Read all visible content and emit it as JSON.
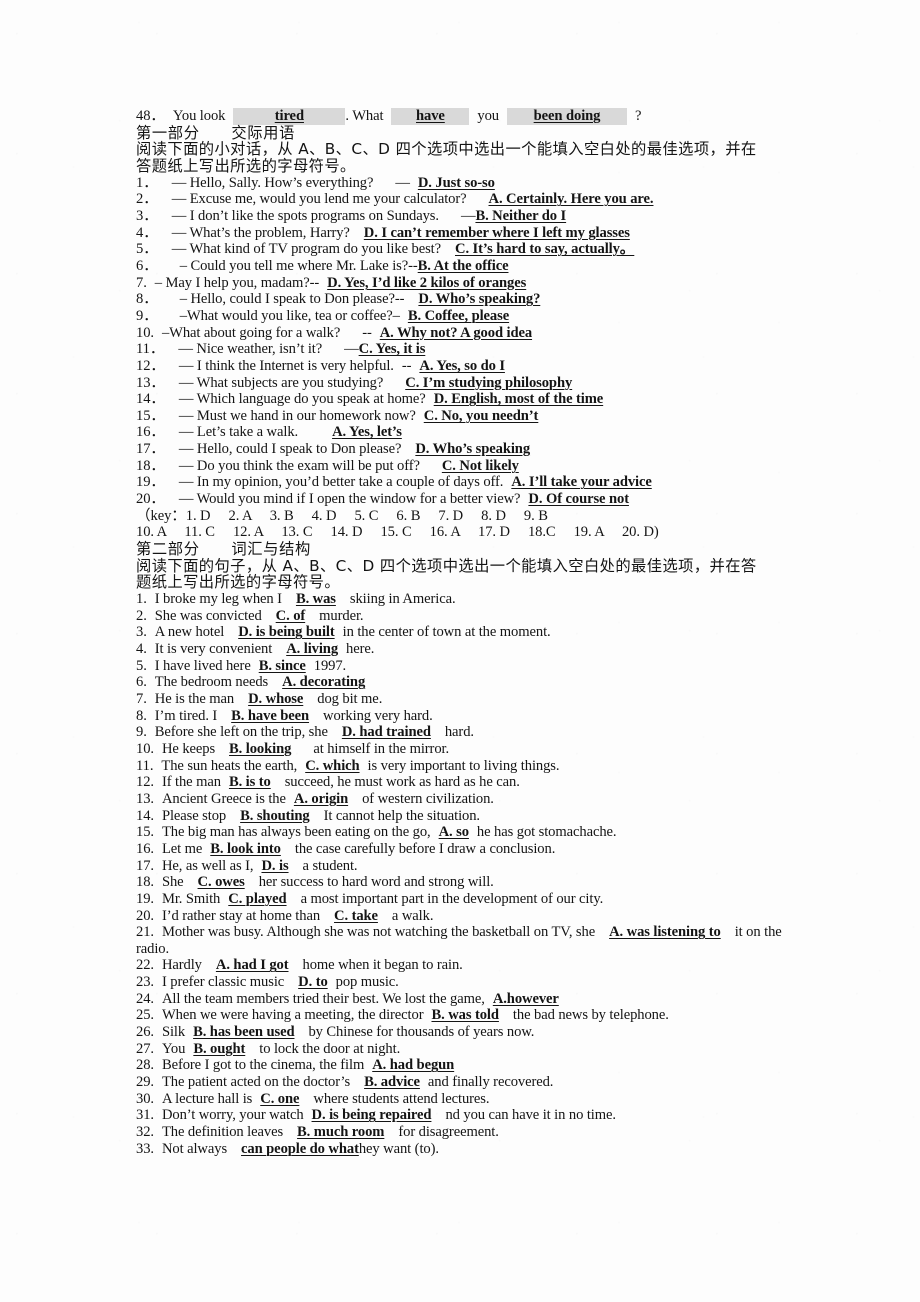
{
  "document": {
    "type": "scanned-exam-worksheet",
    "language": "en-zh"
  },
  "line48": {
    "number": "48．",
    "text_you_look": "You look",
    "blank1": "tired",
    "text_dot_what": ". What",
    "blank2": "have",
    "text_you": "you",
    "blank3": "been doing",
    "text_q": "?"
  },
  "part1": {
    "heading": "第一部分　　交际用语",
    "instruction_line1": "阅读下面的小对话，从 A、B、C、D 四个选项中选出一个能填入空白处的最佳选项，并在",
    "instruction_line2": "答题纸上写出所选的字母符号。",
    "items": [
      {
        "num": "1．",
        "prompt": "— Hello, Sally. How’s everything?",
        "dash": "—",
        "answer": "D. Just so-so"
      },
      {
        "num": "2．",
        "prompt": "— Excuse me, would you lend me your calculator?",
        "dash": "",
        "answer": "A. Certainly. Here you are."
      },
      {
        "num": "3．",
        "prompt": "— I don’t like the spots programs on Sundays.",
        "dash": "—",
        "answer": "B. Neither do I"
      },
      {
        "num": " 4．",
        "prompt": "— What’s the problem, Harry?",
        "dash": "",
        "answer": "D. I can’t remember where I left my glasses"
      },
      {
        "num": "5．",
        "prompt": "— What kind of TV program do you like best?",
        "dash": "",
        "answer": "C. It’s hard to say, actually。"
      },
      {
        "num": "6．",
        "prompt": "– Could you tell me where Mr. Lake is?",
        "dash": "--",
        "answer": "B. At the office"
      },
      {
        "num": "7.",
        "prompt": "– May I help you, madam?",
        "dash": "--",
        "answer": "D. Yes, I’d like 2 kilos of oranges"
      },
      {
        "num": "8．",
        "prompt": "– Hello, could I speak to Don please?",
        "dash": "--",
        "answer": "D. Who’s speaking?"
      },
      {
        "num": "9．",
        "prompt": "–What would you like, tea or coffee?",
        "dash": "–",
        "answer": "B. Coffee, please"
      },
      {
        "num": "10.",
        "prompt": "–What about going for a walk?",
        "dash": "--",
        "answer": "A. Why not? A good idea"
      },
      {
        "num": "11．",
        "prompt": "— Nice weather, isn’t it?",
        "dash": "—",
        "answer": "C. Yes, it is"
      },
      {
        "num": "12．",
        "prompt": "— I think the Internet is very helpful.",
        "dash": "--",
        "answer": "A. Yes, so do I"
      },
      {
        "num": "13．",
        "prompt": "— What subjects are you studying?",
        "dash": "",
        "answer": "C. I’m studying philosophy"
      },
      {
        "num": "14．",
        "prompt": "— Which language do you speak at home?",
        "dash": "",
        "answer": "D. English, most of the time"
      },
      {
        "num": "15．",
        "prompt": "— Must we hand in our homework now?",
        "dash": "",
        "answer": "C. No, you needn’t"
      },
      {
        "num": "16．",
        "prompt": "— Let’s take a walk.",
        "dash": "",
        "answer": "A. Yes, let’s"
      },
      {
        "num": "17．",
        "prompt": "— Hello, could I speak to Don please?",
        "dash": "",
        "answer": "D. Who’s speaking"
      },
      {
        "num": "18．",
        "prompt": "— Do you think the exam will be put off?",
        "dash": "",
        "answer": "C. Not likely"
      },
      {
        "num": "19．",
        "prompt": "— In my opinion, you’d better take a couple of days off.",
        "dash": "",
        "answer": "A. I’ll take your advice"
      },
      {
        "num": "20．",
        "prompt": "— Would you mind if I open the window for a better view?",
        "dash": "",
        "answer": "D. Of course not"
      }
    ],
    "key_line1": "（key：1. D　 2. A　 3. B　  4. D　 5. C　  6. B　  7. D　 8. D　 9. B",
    "key_line2": "10. A　 11. C　 12. A　  13. C　 14. D　  15. C　  16. A　 17. D　 18.C　 19. A　  20. D)"
  },
  "part2": {
    "heading": "第二部分　　词汇与结构",
    "instruction_line1": "阅读下面的句子，从 A、B、C、D 四个选项中选出一个能填入空白处的最佳选项，并在答",
    "instruction_line2": "题纸上写出所选的字母符号。",
    "items": [
      {
        "num": "1.",
        "before": "I broke my leg when I",
        "answer": "B. was",
        "after": "skiing in America."
      },
      {
        "num": "2.",
        "before": "She was convicted",
        "answer": "C. of",
        "after": "murder."
      },
      {
        "num": "3.",
        "before": "A new hotel",
        "answer": "D. is being built",
        "after": "in the center of town at the moment."
      },
      {
        "num": "4.",
        "before": "It is very convenient",
        "answer": "A. living",
        "after": "here."
      },
      {
        "num": "5.",
        "before": "I have lived here",
        "answer": "B. since",
        "after": "1997."
      },
      {
        "num": "6.",
        "before": "The bedroom needs",
        "answer": "A. decorating",
        "after": ""
      },
      {
        "num": "7.",
        "before": "He is the man",
        "answer": "D. whose",
        "after": "dog bit me."
      },
      {
        "num": "8.",
        "before": "I’m tired. I",
        "answer": "B. have been",
        "after": "working very hard."
      },
      {
        "num": "9.",
        "before": "Before she left on the trip, she",
        "answer": "D. had trained",
        "after": "hard."
      },
      {
        "num": "10.",
        "before": "He keeps",
        "answer": "B. looking",
        "after": "at himself in the mirror."
      },
      {
        "num": "11.",
        "before": "The sun heats the earth,",
        "answer": "C. which",
        "after": "is very important to living things."
      },
      {
        "num": "12.",
        "before": "If the man",
        "answer": "B. is to",
        "after": "succeed, he must work as hard as he can."
      },
      {
        "num": "13.",
        "before": "Ancient Greece is the",
        "answer": "A. origin",
        "after": "of western civilization."
      },
      {
        "num": "14.",
        "before": "Please stop",
        "answer": "B. shouting",
        "after": "It cannot help the situation."
      },
      {
        "num": "15.",
        "before": "The big man has always been eating on the go,",
        "answer": "A. so",
        "after": "he has got stomachache."
      },
      {
        "num": "16.",
        "before": "Let me",
        "answer": "B. look into",
        "after": "the case carefully before I draw a conclusion."
      },
      {
        "num": "17.",
        "before": "He, as well as I,",
        "answer": "D. is",
        "after": "a student."
      },
      {
        "num": "18.",
        "before": "She",
        "answer": "C. owes",
        "after": "her success to hard word and strong will."
      },
      {
        "num": "19.",
        "before": "Mr. Smith",
        "answer": "C. played",
        "after": "a most important part in the development of our city."
      },
      {
        "num": "20.",
        "before": "I’d rather stay at home than",
        "answer": "C. take",
        "after": "a walk."
      },
      {
        "num": "21.",
        "before": "Mother was busy. Although she was not watching the basketball on TV, she",
        "answer": "A. was listening to",
        "after": "it on the radio."
      },
      {
        "num": "22.",
        "before": "Hardly",
        "answer": "A. had I got",
        "after": "home when it began to rain."
      },
      {
        "num": "23.",
        "before": "I prefer classic music",
        "answer": "D. to",
        "after": "pop music."
      },
      {
        "num": "24.",
        "before": "All the team members tried their best. We lost the game,",
        "answer": "A.however",
        "after": ""
      },
      {
        "num": "25.",
        "before": "When we were having a meeting, the director",
        "answer": "B. was told",
        "after": "the bad news by telephone."
      },
      {
        "num": "26.",
        "before": "Silk",
        "answer": "B. has been used",
        "after": "by Chinese for thousands of years now."
      },
      {
        "num": "27.",
        "before": "You",
        "answer": "B. ought",
        "after": "to lock the door at night."
      },
      {
        "num": "28.",
        "before": "Before I got to the cinema, the film",
        "answer": "A. had begun",
        "after": ""
      },
      {
        "num": "29.",
        "before": "The patient acted on the doctor’s",
        "answer": "B. advice",
        "after": "and finally recovered."
      },
      {
        "num": "30.",
        "before": "A lecture hall is",
        "answer": "C. one",
        "after": "where students attend lectures."
      },
      {
        "num": "31.",
        "before": "Don’t worry, your watch",
        "answer": "D. is being repaired",
        "after": "nd you can have it in no time."
      },
      {
        "num": "32.",
        "before": "The definition leaves",
        "answer": "B. much room",
        "after": "for disagreement."
      },
      {
        "num": "33.",
        "before": "Not always",
        "answer": "can people do what",
        "after": "hey want (to)."
      }
    ]
  }
}
